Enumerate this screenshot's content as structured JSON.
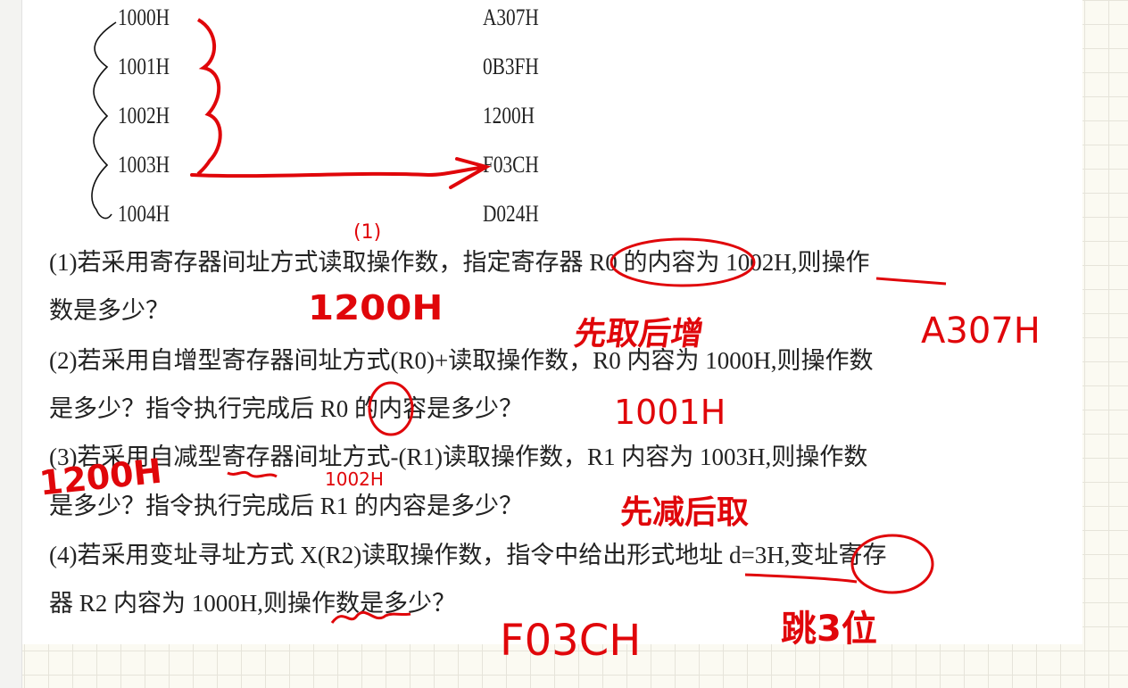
{
  "memory_table": {
    "addresses": [
      "1000H",
      "1001H",
      "1002H",
      "1003H",
      "1004H"
    ],
    "values": [
      "A307H",
      "0B3FH",
      "1200H",
      "F03CH",
      "D024H"
    ]
  },
  "question_lines": [
    "(1)若采用寄存器间址方式读取操作数，指定寄存器 R0 的内容为 1002H,则操作",
    "数是多少？",
    "(2)若采用自增型寄存器间址方式(R0)+读取操作数，R0 内容为 1000H,则操作数",
    "是多少？指令执行完成后 R0 的内容是多少？",
    "(3)若采用自减型寄存器间址方式-(R1)读取操作数，R1 内容为 1003H,则操作数",
    "是多少？指令执行完成后 R1 的内容是多少？",
    "(4)若采用变址寻址方式 X(R2)读取操作数，指令中给出形式地址 d=3H,变址寄存",
    "器 R2 内容为 1000H,则操作数是多少？"
  ],
  "handwritten": {
    "label_1": "(1)",
    "answer_1": "1200H",
    "note_2": "先取后增",
    "answer_2": "A307H",
    "answer_2b": "1001H",
    "answer_3": "1200H",
    "answer_3b": "1002H",
    "note_3": "先减后取",
    "answer_4": "F03CH",
    "note_4": "跳3位"
  },
  "colors": {
    "ink": "#e0060a",
    "paper": "#ffffff",
    "grid": "#fbfaf2"
  }
}
